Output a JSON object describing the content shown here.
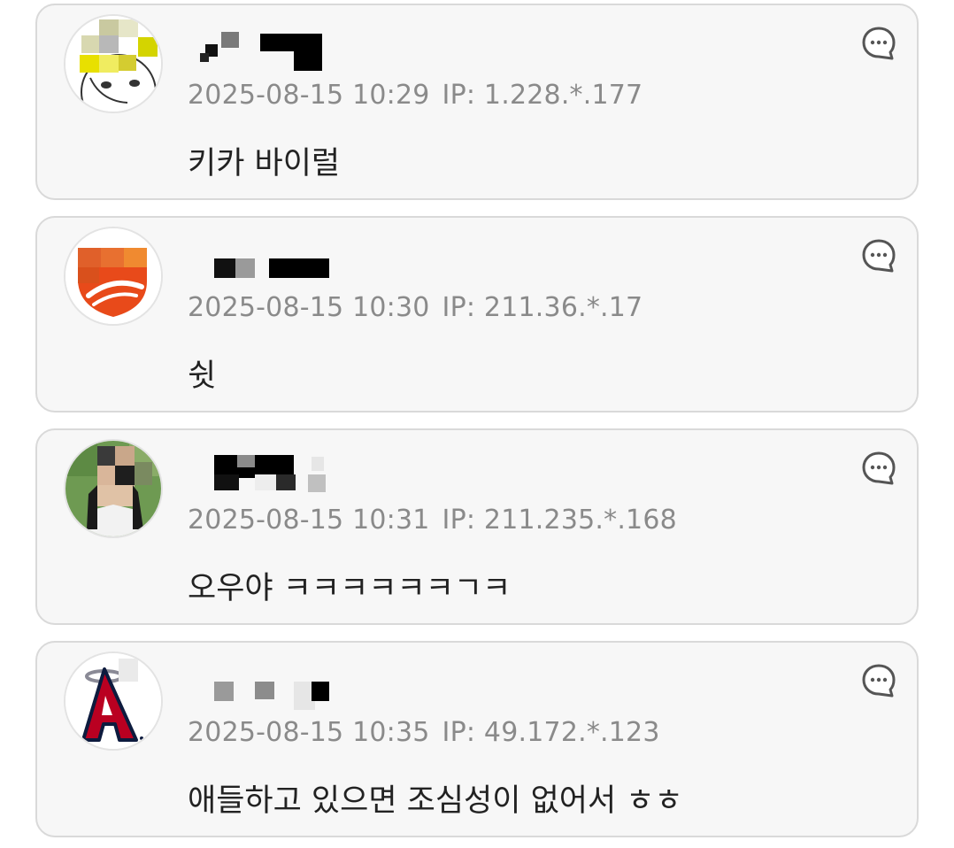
{
  "comments": [
    {
      "timestamp": "2025-08-15 10:29",
      "ip": "IP: 1.228.*.177",
      "text": "키카 바이럴",
      "avatar_icon": "pixelated-cartoon-avatar",
      "username_redacted": true
    },
    {
      "timestamp": "2025-08-15 10:30",
      "ip": "IP: 211.36.*.17",
      "text": "쉿",
      "avatar_icon": "orange-shield-logo-avatar",
      "username_redacted": true
    },
    {
      "timestamp": "2025-08-15 10:31",
      "ip": "IP: 211.235.*.168",
      "text": "오우야 ㅋㅋㅋㅋㅋㅋㄱㅋ",
      "avatar_icon": "pixelated-photo-avatar",
      "username_redacted": true
    },
    {
      "timestamp": "2025-08-15 10:35",
      "ip": "IP: 49.172.*.123",
      "text": "애들하고 있으면 조심성이 없어서 ㅎㅎ",
      "avatar_icon": "angels-logo-avatar",
      "username_redacted": true
    }
  ],
  "reply_icon": "chat-bubble-icon",
  "colors": {
    "card_background": "#f7f7f7",
    "card_border": "#d9d9d9",
    "meta_text": "#8a8a8a",
    "content_text": "#222222",
    "icon_stroke": "#555555"
  }
}
